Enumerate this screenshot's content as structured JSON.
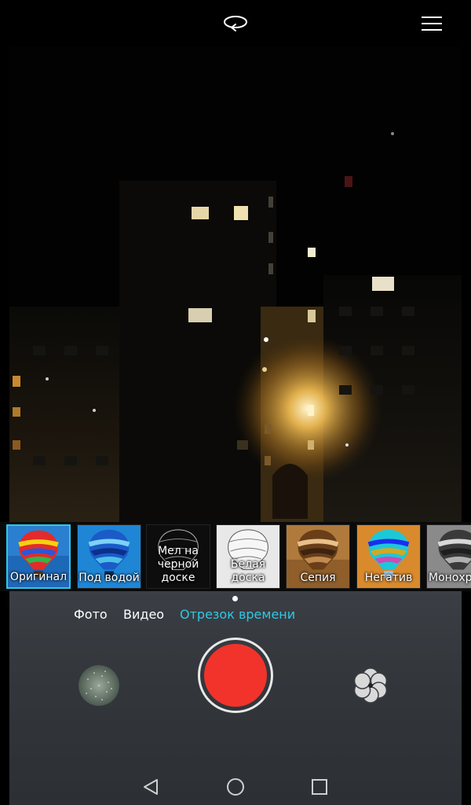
{
  "colors": {
    "accent": "#2ec8e6",
    "shutter_red": "#f2332b",
    "controls_bg": "#363a3f"
  },
  "top_bar": {
    "rotate_icon": "switch-camera-icon",
    "menu_icon": "hamburger-menu-icon"
  },
  "filters": [
    {
      "label": "Оригинал",
      "selected": true
    },
    {
      "label": "Под водой",
      "selected": false
    },
    {
      "label_lines": [
        "Мел на",
        "черной",
        "доске"
      ],
      "selected": false
    },
    {
      "label_lines": [
        "Белая",
        "доска"
      ],
      "selected": false
    },
    {
      "label": "Сепия",
      "selected": false
    },
    {
      "label": "Негатив",
      "selected": false
    },
    {
      "label": "Монохр",
      "selected": false
    }
  ],
  "modes": [
    {
      "label": "Фото",
      "active": false
    },
    {
      "label": "Видео",
      "active": false
    },
    {
      "label": "Отрезок времени",
      "active": true
    }
  ],
  "controls": {
    "gallery_icon": "gallery-thumbnail",
    "shutter_icon": "record-button",
    "filter_icon": "filter-flower-icon"
  },
  "nav": {
    "back_icon": "back-triangle-icon",
    "home_icon": "home-circle-icon",
    "recents_icon": "recents-square-icon"
  }
}
